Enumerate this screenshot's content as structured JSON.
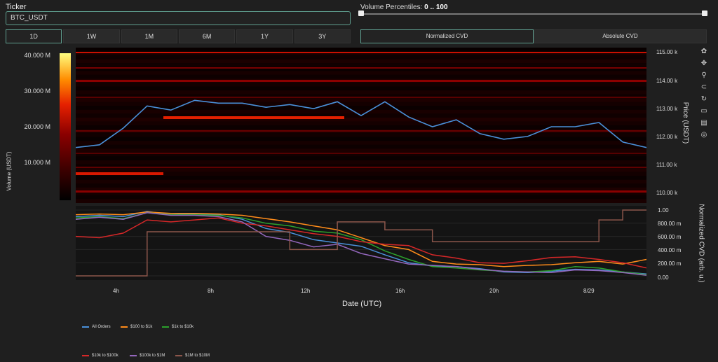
{
  "ticker": {
    "label": "Ticker",
    "value": "BTC_USDT"
  },
  "ranges": [
    "1D",
    "1W",
    "1M",
    "6M",
    "1Y",
    "3Y"
  ],
  "percentiles": {
    "label": "Volume Percentiles:",
    "range": "0 .. 100"
  },
  "modes": [
    "Normalized CVD",
    "Absolute CVD"
  ],
  "heatmap": {
    "colorbar_ticks": [
      "40.000 M",
      "30.000 M",
      "20.000 M",
      "10.000 M"
    ],
    "colorbar_title": "Volume (USDT)",
    "price_ticks": [
      "115.00 k",
      "114.00 k",
      "113.00 k",
      "112.00 k",
      "111.00 k",
      "110.00 k"
    ],
    "price_title": "Price (USDT)"
  },
  "cvd": {
    "y_ticks": [
      "1.00",
      "800.00 m",
      "600.00 m",
      "400.00 m",
      "200.00 m",
      "0.00"
    ],
    "y_title": "Normalized CVD (arb. u.)"
  },
  "x_axis": {
    "ticks": [
      "4h",
      "8h",
      "12h",
      "16h",
      "20h",
      "8/29"
    ],
    "title": "Date (UTC)"
  },
  "toolbar": [
    "color-wheel-icon",
    "pan-icon",
    "zoom-icon",
    "lasso-icon",
    "reset-icon",
    "save-icon",
    "comment-icon",
    "target-icon"
  ],
  "legend": [
    {
      "name": "All Orders",
      "color": "#4a90d9"
    },
    {
      "name": "$100 to $1k",
      "color": "#ff8c1a"
    },
    {
      "name": "$1k to $10k",
      "color": "#2ca02c"
    },
    {
      "name": "$10k to $100k",
      "color": "#d62728"
    },
    {
      "name": "$100k to $1M",
      "color": "#9467bd"
    },
    {
      "name": "$1M to $10M",
      "color": "#8c564b"
    }
  ],
  "chart_data": [
    {
      "type": "line",
      "title": "",
      "xlabel": "Date (UTC)",
      "ylabel": "Price (USDT)",
      "ylim": [
        109600,
        115200
      ],
      "x": [
        "2h",
        "3h",
        "4h",
        "5h",
        "6h",
        "7h",
        "8h",
        "9h",
        "10h",
        "11h",
        "12h",
        "13h",
        "14h",
        "15h",
        "16h",
        "17h",
        "18h",
        "19h",
        "20h",
        "21h",
        "22h",
        "23h",
        "8/29 0h",
        "1h",
        "2h"
      ],
      "series": [
        {
          "name": "price",
          "values": [
            111600,
            111700,
            112300,
            113100,
            112950,
            113300,
            113200,
            113200,
            113050,
            113150,
            113000,
            113250,
            112750,
            113250,
            112700,
            112350,
            112600,
            112100,
            111900,
            112000,
            112350,
            112350,
            112500,
            111800,
            111600
          ]
        }
      ]
    },
    {
      "type": "line",
      "title": "",
      "xlabel": "Date (UTC)",
      "ylabel": "Normalized CVD (arb. u.)",
      "ylim": [
        0,
        1
      ],
      "x": [
        "2h",
        "3h",
        "4h",
        "5h",
        "6h",
        "7h",
        "8h",
        "9h",
        "10h",
        "11h",
        "12h",
        "13h",
        "14h",
        "15h",
        "16h",
        "17h",
        "18h",
        "19h",
        "20h",
        "21h",
        "22h",
        "23h",
        "8/29 0h",
        "1h",
        "2h"
      ],
      "series": [
        {
          "name": "All Orders",
          "values": [
            0.9,
            0.92,
            0.9,
            0.98,
            0.93,
            0.94,
            0.93,
            0.86,
            0.72,
            0.66,
            0.55,
            0.5,
            0.45,
            0.32,
            0.2,
            0.15,
            0.14,
            0.11,
            0.06,
            0.05,
            0.07,
            0.1,
            0.09,
            0.06,
            0.03
          ]
        },
        {
          "name": "$100 to $1k",
          "values": [
            0.93,
            0.94,
            0.93,
            0.97,
            0.95,
            0.95,
            0.94,
            0.92,
            0.87,
            0.82,
            0.76,
            0.7,
            0.58,
            0.46,
            0.4,
            0.22,
            0.18,
            0.17,
            0.14,
            0.16,
            0.17,
            0.2,
            0.22,
            0.18,
            0.25
          ]
        },
        {
          "name": "$1k to $10k",
          "values": [
            0.88,
            0.9,
            0.87,
            0.96,
            0.93,
            0.93,
            0.92,
            0.88,
            0.8,
            0.76,
            0.68,
            0.65,
            0.55,
            0.38,
            0.25,
            0.14,
            0.12,
            0.09,
            0.07,
            0.06,
            0.08,
            0.14,
            0.12,
            0.06,
            0.02
          ]
        },
        {
          "name": "$10k to $100k",
          "values": [
            0.6,
            0.58,
            0.65,
            0.85,
            0.82,
            0.85,
            0.88,
            0.8,
            0.76,
            0.7,
            0.64,
            0.6,
            0.52,
            0.48,
            0.46,
            0.32,
            0.27,
            0.2,
            0.19,
            0.23,
            0.28,
            0.29,
            0.25,
            0.2,
            0.12
          ]
        },
        {
          "name": "$100k to $1M",
          "values": [
            0.86,
            0.89,
            0.86,
            0.96,
            0.92,
            0.92,
            0.9,
            0.82,
            0.6,
            0.54,
            0.44,
            0.48,
            0.34,
            0.26,
            0.18,
            0.16,
            0.14,
            0.1,
            0.07,
            0.06,
            0.05,
            0.09,
            0.08,
            0.05,
            0.01
          ]
        },
        {
          "name": "$1M to $10M",
          "values": [
            0.0,
            0.0,
            0.0,
            0.67,
            0.67,
            0.67,
            0.67,
            0.67,
            0.67,
            0.4,
            0.4,
            0.82,
            0.82,
            0.7,
            0.7,
            0.52,
            0.52,
            0.52,
            0.52,
            0.52,
            0.52,
            0.52,
            0.85,
            1.0,
            1.0
          ]
        }
      ]
    }
  ]
}
